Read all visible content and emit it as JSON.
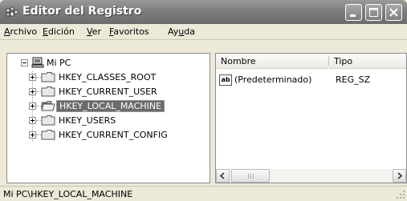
{
  "window": {
    "title": "Editor del Registro"
  },
  "menu": [
    {
      "pre": "",
      "key": "A",
      "post": "rchivo"
    },
    {
      "pre": "",
      "key": "E",
      "post": "dición"
    },
    {
      "pre": "",
      "key": "V",
      "post": "er"
    },
    {
      "pre": "",
      "key": "F",
      "post": "avoritos"
    },
    {
      "pre": "Ay",
      "key": "u",
      "post": "da"
    }
  ],
  "tree": {
    "root": "Mi PC",
    "items": [
      {
        "label": "HKEY_CLASSES_ROOT",
        "selected": false
      },
      {
        "label": "HKEY_CURRENT_USER",
        "selected": false
      },
      {
        "label": "HKEY_LOCAL_MACHINE",
        "selected": true
      },
      {
        "label": "HKEY_USERS",
        "selected": false
      },
      {
        "label": "HKEY_CURRENT_CONFIG",
        "selected": false
      }
    ]
  },
  "list": {
    "columns": [
      "Nombre",
      "Tipo"
    ],
    "rows": [
      {
        "icon": "string-value-icon",
        "icon_text": "ab",
        "name": "(Predeterminado)",
        "type": "REG_SZ"
      }
    ]
  },
  "status": {
    "path": "Mi PC\\HKEY_LOCAL_MACHINE"
  }
}
